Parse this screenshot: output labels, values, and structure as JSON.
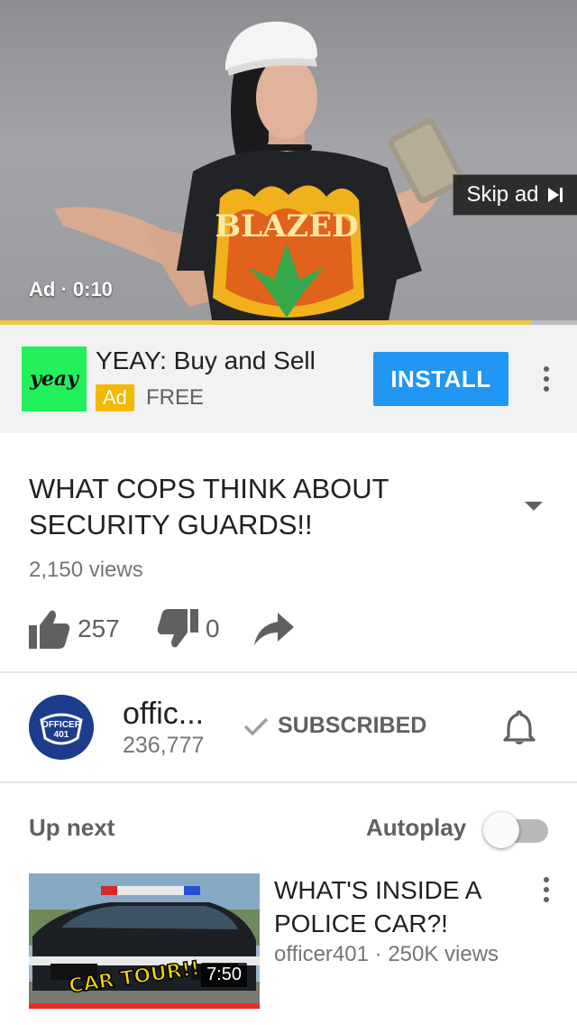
{
  "player": {
    "ad_timer": "Ad · 0:10",
    "skip_label": "Skip ad",
    "shirt_text": "BLAZED",
    "progress_fraction": 0.92,
    "progress_color": "#f2c744"
  },
  "ad_banner": {
    "logo_text": "yeay",
    "title": "YEAY: Buy and Sell",
    "badge": "Ad",
    "price": "FREE",
    "install_label": "INSTALL",
    "install_color": "#2196f3",
    "menu_icon": "more-vert-icon"
  },
  "video": {
    "title": "WHAT COPS THINK ABOUT SECURITY GUARDS!!",
    "views": "2,150 views",
    "likes": "257",
    "dislikes": "0"
  },
  "channel": {
    "avatar_text_top": "OFFICER",
    "avatar_text_bottom": "401",
    "name": "offic...",
    "subscribers": "236,777",
    "subscribed_label": "SUBSCRIBED"
  },
  "up_next": {
    "heading": "Up next",
    "autoplay_label": "Autoplay",
    "autoplay_on": false,
    "item": {
      "title": "WHAT'S INSIDE A POLICE CAR?!",
      "channel": "officer401",
      "views": "250K views",
      "separator": "·",
      "duration": "7:50",
      "thumb_text": "CAR TOUR!!"
    }
  }
}
